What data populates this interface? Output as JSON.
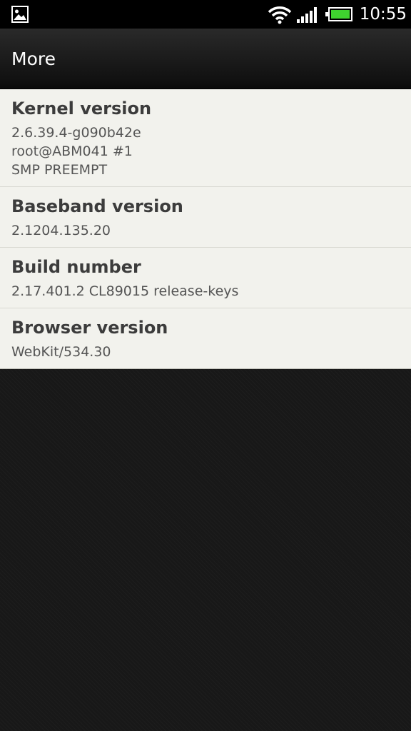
{
  "status_bar": {
    "time": "10:55",
    "icons": [
      "gallery-icon",
      "wifi-icon",
      "signal-icon",
      "battery-icon"
    ],
    "battery_color": "#3fd32f"
  },
  "header": {
    "title": "More"
  },
  "items": [
    {
      "title": "Kernel version",
      "value": "2.6.39.4-g090b42e\nroot@ABM041 #1\nSMP PREEMPT"
    },
    {
      "title": "Baseband version",
      "value": "2.1204.135.20"
    },
    {
      "title": "Build number",
      "value": "2.17.401.2 CL89015 release-keys"
    },
    {
      "title": "Browser version",
      "value": "WebKit/534.30"
    }
  ]
}
